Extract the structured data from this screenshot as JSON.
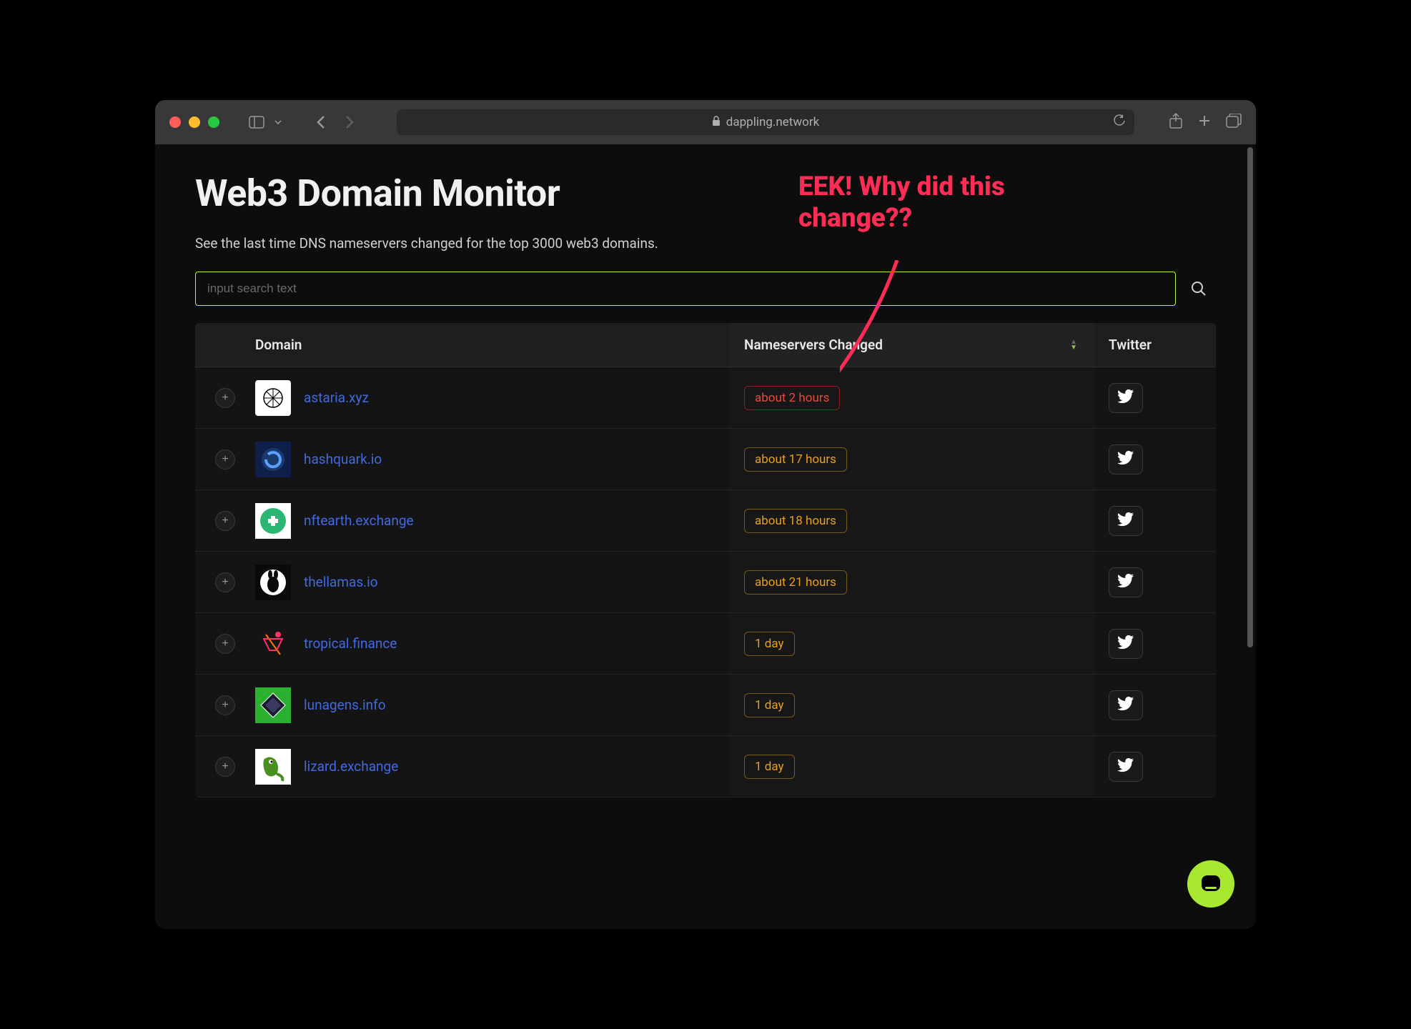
{
  "browser": {
    "url": "dappling.network"
  },
  "page": {
    "title": "Web3 Domain Monitor",
    "subtitle": "See the last time DNS nameservers changed for the top 3000 web3 domains."
  },
  "search": {
    "placeholder": "input search text"
  },
  "table": {
    "headers": {
      "domain": "Domain",
      "nameservers": "Nameservers Changed",
      "twitter": "Twitter"
    },
    "rows": [
      {
        "domain": "astaria.xyz",
        "time": "about 2 hours",
        "badge": "red",
        "icon_class": "icon-astaria"
      },
      {
        "domain": "hashquark.io",
        "time": "about 17 hours",
        "badge": "orange",
        "icon_class": "icon-hashquark"
      },
      {
        "domain": "nftearth.exchange",
        "time": "about 18 hours",
        "badge": "orange",
        "icon_class": "icon-nftearth"
      },
      {
        "domain": "thellamas.io",
        "time": "about 21 hours",
        "badge": "orange",
        "icon_class": "icon-thellamas"
      },
      {
        "domain": "tropical.finance",
        "time": "1 day",
        "badge": "orange",
        "icon_class": "icon-tropical"
      },
      {
        "domain": "lunagens.info",
        "time": "1 day",
        "badge": "orange",
        "icon_class": "icon-lunagens"
      },
      {
        "domain": "lizard.exchange",
        "time": "1 day",
        "badge": "orange",
        "icon_class": "icon-lizard"
      }
    ]
  },
  "annotation": {
    "text": "EEK! Why did this change??"
  }
}
